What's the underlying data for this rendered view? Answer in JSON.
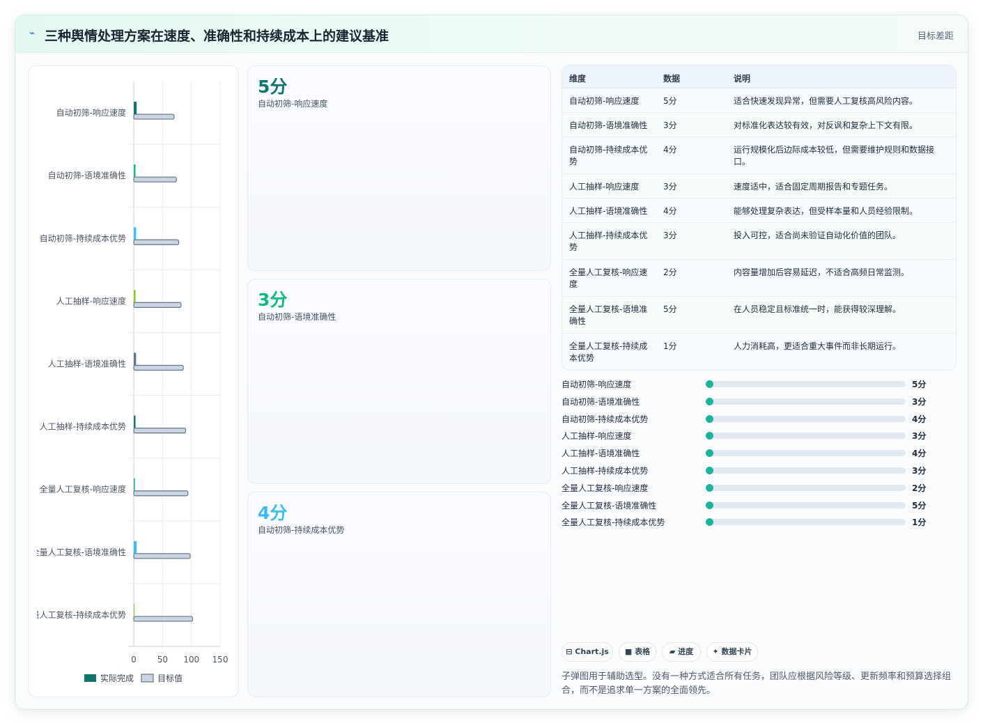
{
  "header": {
    "icon": "bolt-icon",
    "title": "三种舆情处理方案在速度、准确性和持续成本上的建议基准",
    "right_label": "目标差距"
  },
  "colors": {
    "actual": [
      "#0f766e",
      "#10b981",
      "#38bdf8",
      "#84cc16",
      "#64748b",
      "#0f766e",
      "#10b981",
      "#38bdf8",
      "#84cc16"
    ],
    "target_fill": "#cbd5e1",
    "target_stroke": "#64748b",
    "progress": "#1bb39a"
  },
  "chart_data": {
    "type": "bar",
    "orientation": "horizontal",
    "categories": [
      "自动初筛-响应速度",
      "自动初筛-语境准确性",
      "自动初筛-持续成本优势",
      "人工抽样-响应速度",
      "人工抽样-语境准确性",
      "人工抽样-持续成本优势",
      "全量人工复核-响应速度",
      "全量人工复核-语境准确性",
      "全量人工复核-持续成本优势"
    ],
    "series": [
      {
        "name": "实际完成",
        "values": [
          5,
          3,
          4,
          3,
          4,
          3,
          2,
          5,
          1
        ]
      },
      {
        "name": "目标值",
        "values": [
          70,
          74,
          78,
          82,
          86,
          90,
          94,
          98,
          102
        ]
      }
    ],
    "xlim": [
      0,
      150
    ],
    "xticks": [
      "0",
      "50",
      "100",
      "150"
    ],
    "grid": true,
    "legend": "bottom"
  },
  "cards": [
    {
      "value": "5分",
      "label": "自动初筛-响应速度",
      "color": "#0f766e"
    },
    {
      "value": "3分",
      "label": "自动初筛-语境准确性",
      "color": "#10b981"
    },
    {
      "value": "4分",
      "label": "自动初筛-持续成本优势",
      "color": "#38bdf8"
    }
  ],
  "table": {
    "headers": [
      "维度",
      "数据",
      "说明"
    ],
    "rows": [
      [
        "自动初筛-响应速度",
        "5分",
        "适合快速发现异常，但需要人工复核高风险内容。"
      ],
      [
        "自动初筛-语境准确性",
        "3分",
        "对标准化表达较有效，对反讽和复杂上下文有限。"
      ],
      [
        "自动初筛-持续成本优势",
        "4分",
        "运行规模化后边际成本较低，但需要维护规则和数据接口。"
      ],
      [
        "人工抽样-响应速度",
        "3分",
        "速度适中，适合固定周期报告和专题任务。"
      ],
      [
        "人工抽样-语境准确性",
        "4分",
        "能够处理复杂表达，但受样本量和人员经验限制。"
      ],
      [
        "人工抽样-持续成本优势",
        "3分",
        "投入可控，适合尚未验证自动化价值的团队。"
      ],
      [
        "全量人工复核-响应速度",
        "2分",
        "内容量增加后容易延迟，不适合高频日常监测。"
      ],
      [
        "全量人工复核-语境准确性",
        "5分",
        "在人员稳定且标准统一时，能获得较深理解。"
      ],
      [
        "全量人工复核-持续成本优势",
        "1分",
        "人力消耗高，更适合重大事件而非长期运行。"
      ]
    ]
  },
  "progress": [
    {
      "label": "自动初筛-响应速度",
      "value": "5分",
      "fraction": 0
    },
    {
      "label": "自动初筛-语境准确性",
      "value": "3分",
      "fraction": 0
    },
    {
      "label": "自动初筛-持续成本优势",
      "value": "4分",
      "fraction": 0
    },
    {
      "label": "人工抽样-响应速度",
      "value": "3分",
      "fraction": 0
    },
    {
      "label": "人工抽样-语境准确性",
      "value": "4分",
      "fraction": 0
    },
    {
      "label": "人工抽样-持续成本优势",
      "value": "3分",
      "fraction": 0
    },
    {
      "label": "全量人工复核-响应速度",
      "value": "2分",
      "fraction": 0
    },
    {
      "label": "全量人工复核-语境准确性",
      "value": "5分",
      "fraction": 0
    },
    {
      "label": "全量人工复核-持续成本优势",
      "value": "1分",
      "fraction": 0
    }
  ],
  "tags": [
    {
      "icon": "chart-icon",
      "glyph": "⊟",
      "label": "Chart.js"
    },
    {
      "icon": "table-icon",
      "glyph": "■",
      "label": "表格"
    },
    {
      "icon": "folder-icon",
      "glyph": "▰",
      "label": "进度"
    },
    {
      "icon": "sparkle-icon",
      "glyph": "✦",
      "label": "数据卡片"
    }
  ],
  "note": "子弹图用于辅助选型。没有一种方式适合所有任务，团队应根据风险等级、更新频率和预算选择组合，而不是追求单一方案的全面领先。"
}
